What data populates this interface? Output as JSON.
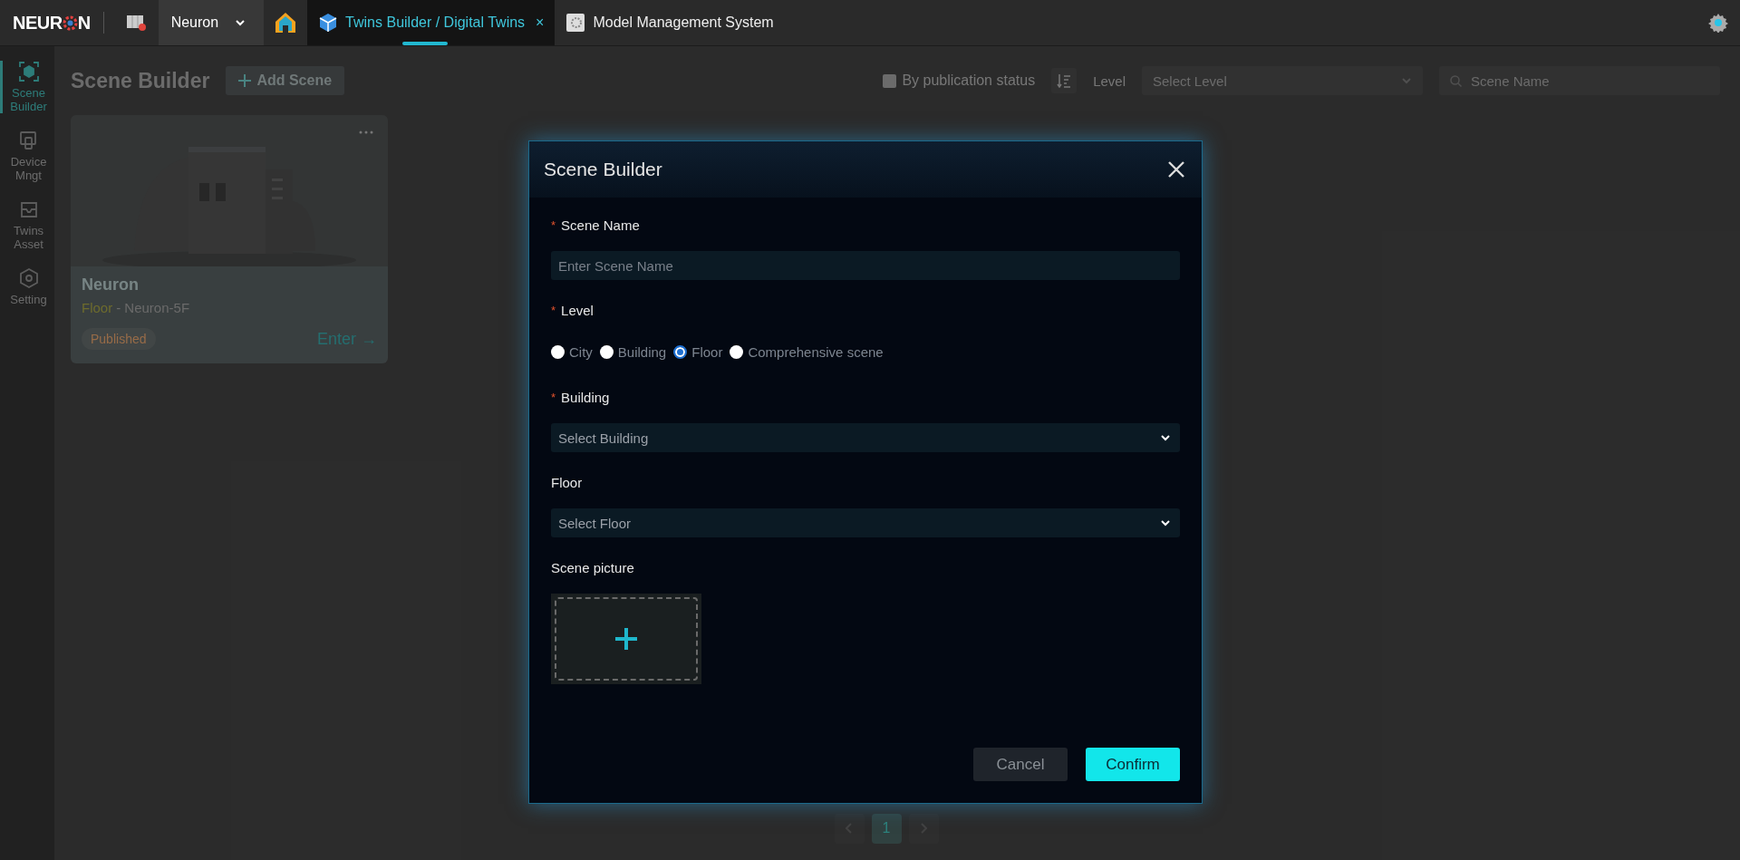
{
  "topbar": {
    "logo": {
      "before": "NEUR",
      "after": "N"
    },
    "app_switcher": {
      "label": "Neuron"
    },
    "tabs": [
      {
        "label": "Twins Builder / Digital Twins",
        "selected": true,
        "close": "×"
      },
      {
        "label": "Model Management System",
        "selected": false
      }
    ]
  },
  "sidebar": {
    "items": [
      {
        "label": "Scene Builder",
        "selected": true
      },
      {
        "label": "Device Mngt",
        "selected": false
      },
      {
        "label": "Twins Asset",
        "selected": false
      },
      {
        "label": "Setting",
        "selected": false
      }
    ]
  },
  "toolbar": {
    "title": "Scene Builder",
    "add_button": "Add Scene",
    "publication_filter": {
      "label": "By publication status",
      "checked": false
    },
    "level": {
      "label": "Level",
      "placeholder": "Select Level"
    },
    "search": {
      "placeholder": "Scene Name"
    }
  },
  "cards": [
    {
      "title": "Neuron",
      "level": "Floor",
      "location": "- Neuron-5F",
      "status": "Published",
      "action": "Enter →"
    }
  ],
  "pagination": {
    "pages": [
      {
        "label": "1",
        "selected": true
      }
    ]
  },
  "dialog": {
    "title": "Scene Builder",
    "fields": [
      {
        "kind": "text",
        "label": "Scene Name",
        "required_mark": "*",
        "placeholder": "Enter Scene Name"
      },
      {
        "kind": "radio",
        "label": "Level",
        "required_mark": "*",
        "options": [
          {
            "label": "City",
            "selected": false
          },
          {
            "label": "Building",
            "selected": false
          },
          {
            "label": "Floor",
            "selected": true
          },
          {
            "label": "Comprehensive scene",
            "selected": false
          }
        ]
      },
      {
        "kind": "select",
        "label": "Building",
        "required_mark": "*",
        "placeholder": "Select Building"
      },
      {
        "kind": "select",
        "label": "Floor",
        "placeholder": "Select Floor"
      },
      {
        "kind": "upload",
        "label": "Scene picture"
      }
    ],
    "buttons": [
      {
        "label": "Cancel",
        "kind": "secondary"
      },
      {
        "label": "Confirm",
        "kind": "primary"
      }
    ]
  }
}
